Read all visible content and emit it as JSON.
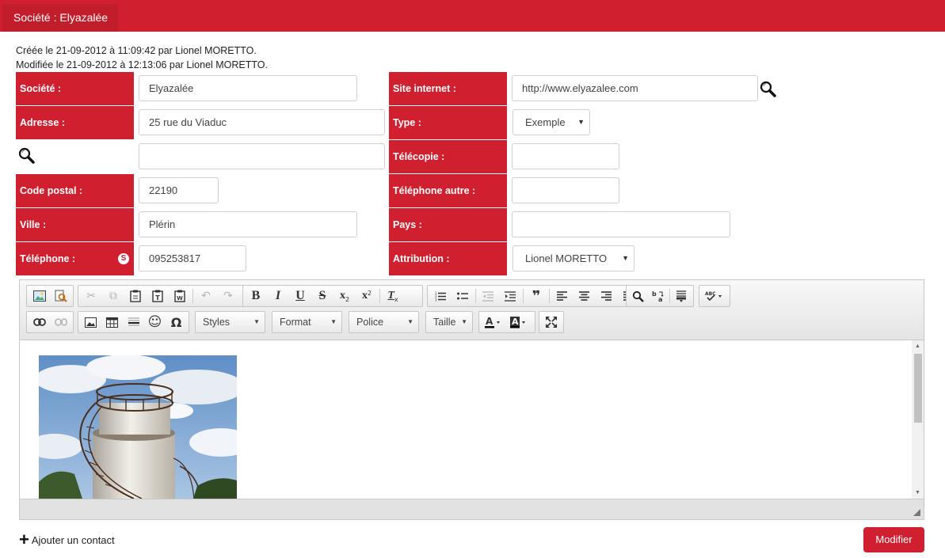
{
  "header": {
    "tab_title": "Société : Elyazalée"
  },
  "meta": {
    "created": "Créée le 21-09-2012 à 11:09:42 par Lionel MORETTO.",
    "modified": "Modifiée le 21-09-2012 à 12:13:06 par Lionel MORETTO."
  },
  "form": {
    "societe": {
      "label": "Société :",
      "value": "Elyazalée"
    },
    "adresse": {
      "label": "Adresse :",
      "value": "25 rue du Viaduc"
    },
    "adresse2": {
      "value": ""
    },
    "code_postal": {
      "label": "Code postal :",
      "value": "22190"
    },
    "ville": {
      "label": "Ville :",
      "value": "Plérin"
    },
    "telephone": {
      "label": "Téléphone :",
      "value": "095253817"
    },
    "site": {
      "label": "Site internet :",
      "value": "http://www.elyazalee.com"
    },
    "type": {
      "label": "Type :",
      "value": "Exemple"
    },
    "telecopie": {
      "label": "Télécopie :",
      "value": ""
    },
    "tel_autre": {
      "label": "Téléphone autre :",
      "value": ""
    },
    "pays": {
      "label": "Pays :",
      "value": ""
    },
    "attribution": {
      "label": "Attribution :",
      "value": "Lionel MORETTO"
    }
  },
  "editor": {
    "combos": {
      "styles": "Styles",
      "format": "Format",
      "police": "Police",
      "taille": "Taille"
    },
    "toolbar_glyphs": {
      "omega": "Ω",
      "quote": "❞",
      "smiley": "☺"
    }
  },
  "footer": {
    "add_contact": "Ajouter un contact",
    "modify": "Modifier"
  },
  "colors": {
    "accent": "#d0202f"
  }
}
